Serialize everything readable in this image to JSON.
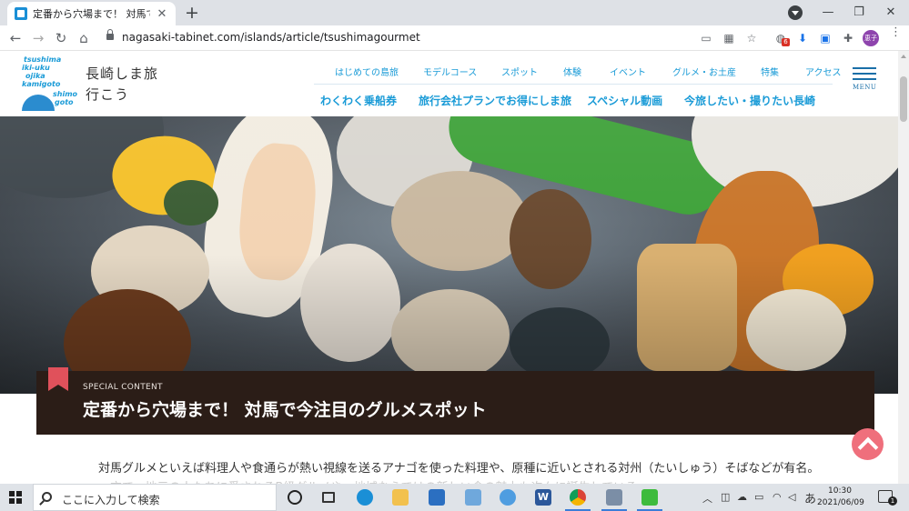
{
  "browser": {
    "tab_title": "定番から穴場まで！ 対馬で今注目のグルメスポット",
    "url": "nagasaki-tabinet.com/islands/article/tsushimagourmet",
    "extension_badge": "6",
    "profile_label": "恵子"
  },
  "site": {
    "logo_words": [
      "tsushima",
      "iki-uku",
      "ojika",
      "kamigoto",
      "shimo",
      "goto"
    ],
    "title_line1": "長崎しま旅",
    "title_line2": "行こう",
    "nav_top": [
      "はじめての島旅",
      "モデルコース",
      "スポット",
      "体験",
      "イベント",
      "グルメ・お土産",
      "特集",
      "アクセス"
    ],
    "nav_main": [
      "わくわく乗船券",
      "旅行会社プランでお得にしま旅",
      "スペシャル動画",
      "今旅したい・撮りたい長崎"
    ],
    "menu_label": "MENU"
  },
  "article": {
    "label": "SPECIAL CONTENT",
    "title": "定番から穴場まで！ 対馬で今注目のグルメスポット",
    "intro": "対馬グルメといえば料理人や食通らが熱い視線を送るアナゴを使った料理や、原種に近いとされる対州（たいしゅう）そばなどが有名。",
    "intro_cut": "一方で、地元の人たちに愛されるB級グルメや、地域ならではの新しい食の魅力も次々に誕生している。"
  },
  "taskbar": {
    "search_placeholder": "ここに入力して検索",
    "ime": "あ",
    "time": "10:30",
    "date": "2021/06/09",
    "notification_count": "1",
    "word_label": "W"
  },
  "colors": {
    "accent_blue": "#1a9bd7",
    "banner_bg": "#2b1d17",
    "bookmark": "#e0515b",
    "pagetop": "#ef6f7c"
  }
}
